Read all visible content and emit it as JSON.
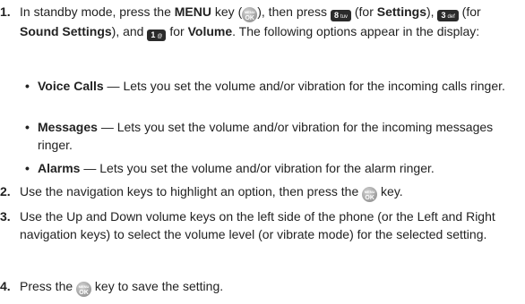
{
  "steps": [
    {
      "num": "1.",
      "t1": "In standby mode, press the ",
      "b1": "MENU",
      "t2": " key (",
      "t3": "), then press ",
      "t4": " (for ",
      "b2": "Settings",
      "t5": "), ",
      "t6": " (for ",
      "b3": "Sound Settings",
      "t7": "), and ",
      "t8": " for ",
      "b4": "Volume",
      "t9": ". The following options appear in the display:"
    },
    {
      "num": "2.",
      "t1": "Use the navigation keys to highlight an option, then press the ",
      "t2": " key."
    },
    {
      "num": "3.",
      "text": "Use the Up and Down volume keys on the left side of the phone (or the Left and Right navigation keys) to select the volume level (or vibrate mode) for the selected setting."
    },
    {
      "num": "4.",
      "t1": "Press the ",
      "t2": " key to save the setting."
    }
  ],
  "options": [
    {
      "bullet": "•",
      "term": "Voice Calls",
      "desc": " — Lets you set the volume and/or vibration for the incoming calls ringer."
    },
    {
      "bullet": "•",
      "term": "Messages",
      "desc": " — Lets you set the volume and/or vibration for the incoming messages ringer."
    },
    {
      "bullet": "•",
      "term": "Alarms",
      "desc": " — Lets you set the volume and/or vibration for the alarm ringer."
    }
  ],
  "keys": {
    "ok_top": "MENU",
    "ok_main": "OK",
    "key8_digit": "8",
    "key8_letters": "tuv",
    "key3_digit": "3",
    "key3_letters": "def",
    "key1_digit": "1",
    "key1_letters": "@"
  },
  "icons": {
    "ok_key": "menu-ok-key-icon",
    "key_8": "key-8-icon",
    "key_3": "key-3-icon",
    "key_1": "key-1-icon"
  }
}
